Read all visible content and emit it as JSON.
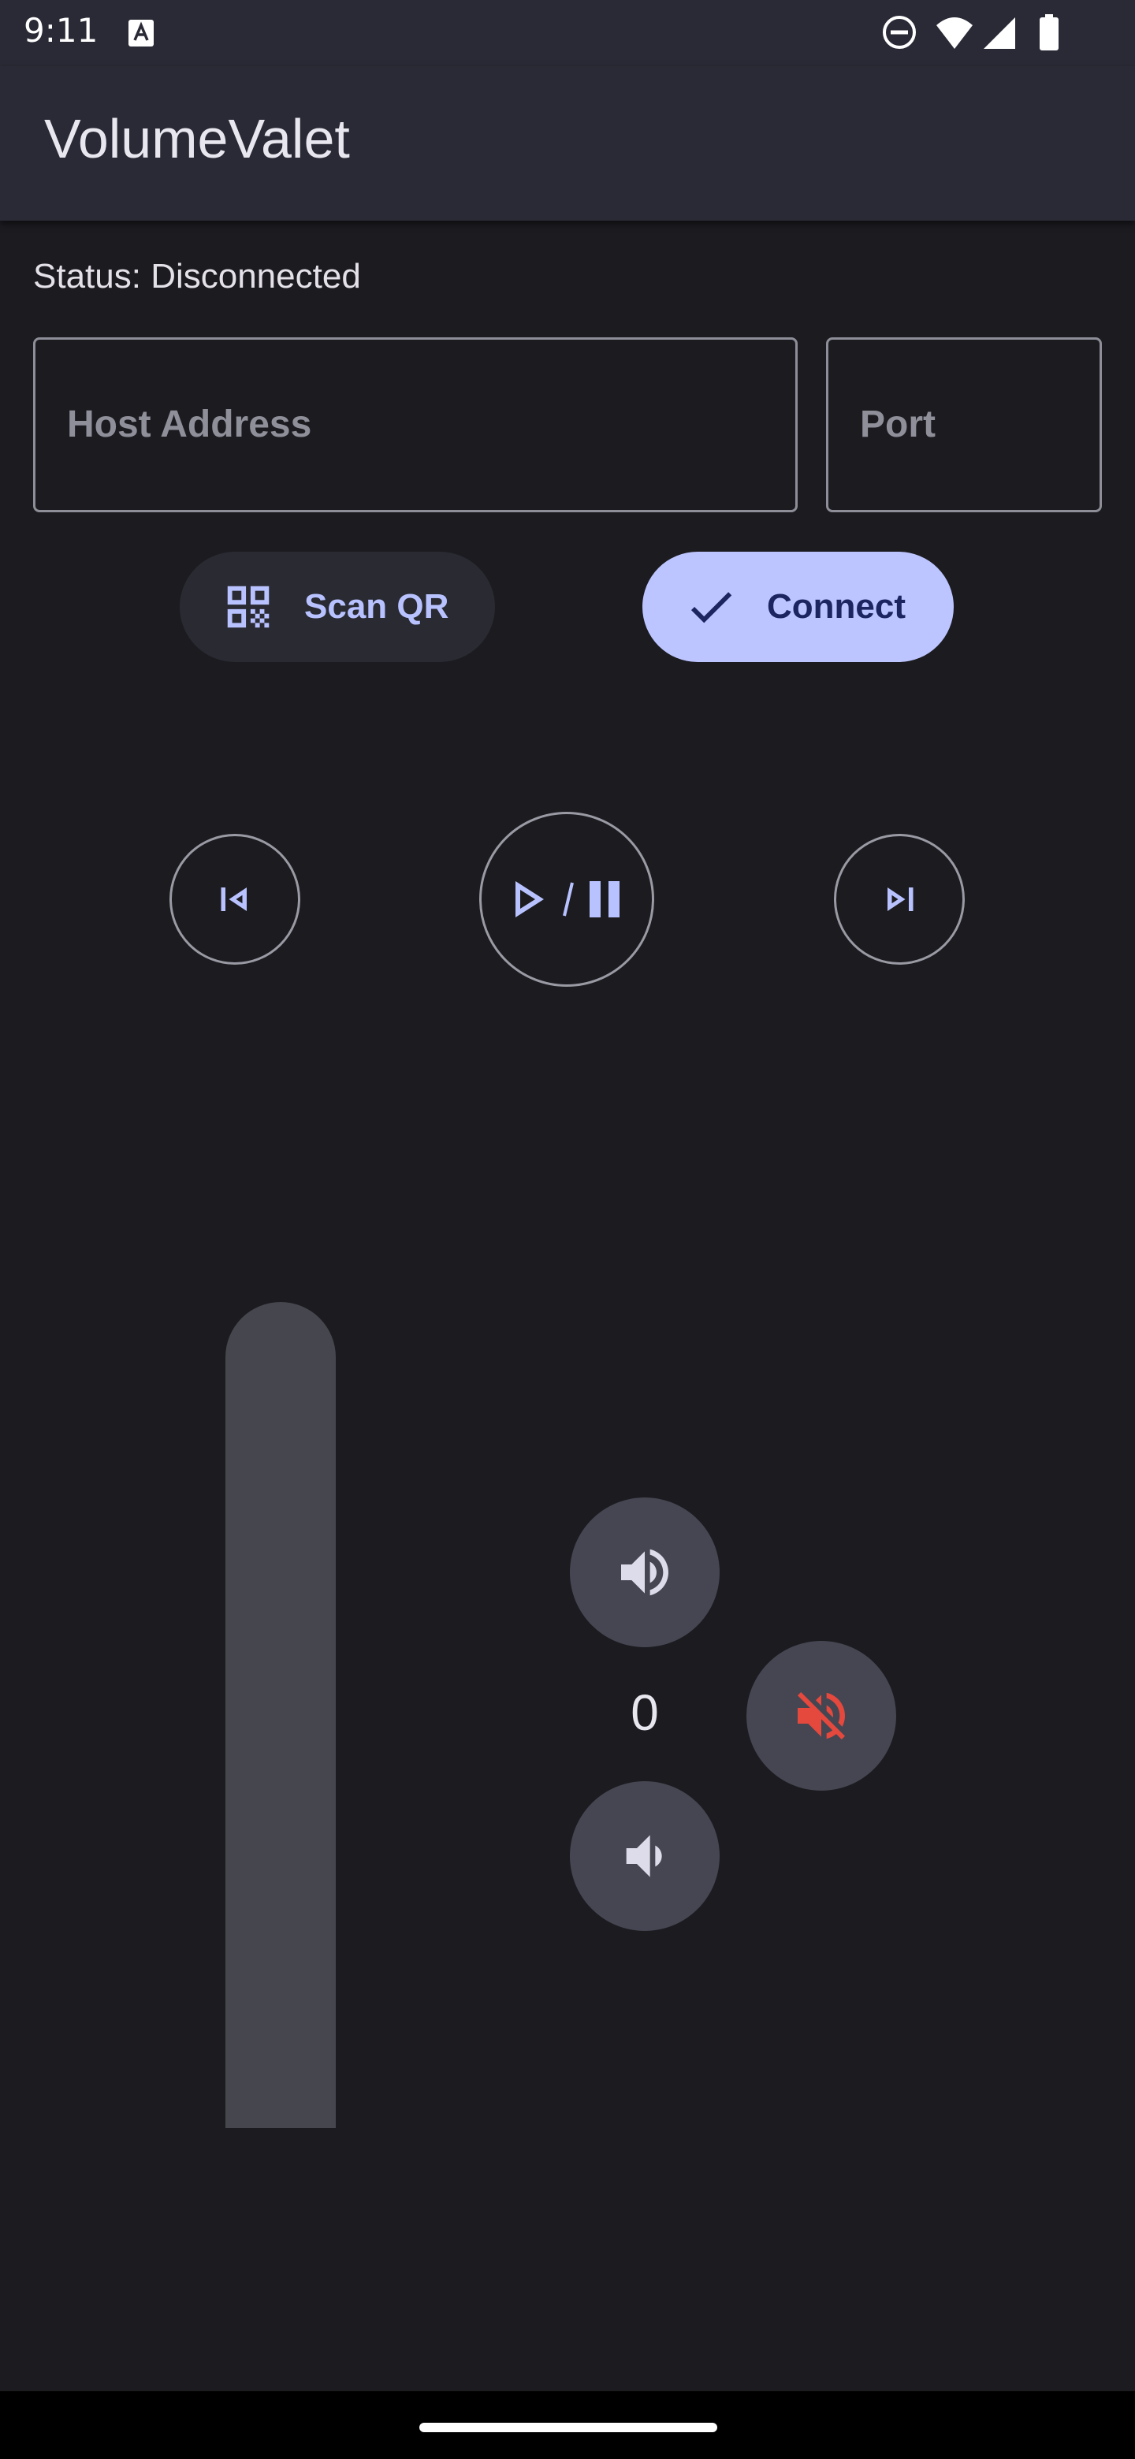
{
  "status_bar": {
    "time": "9:11",
    "icons": [
      "notification-a-icon",
      "do-not-disturb-icon",
      "wifi-icon",
      "cell-signal-icon",
      "battery-icon"
    ]
  },
  "app_bar": {
    "title": "VolumeValet"
  },
  "connection": {
    "status": "Status: Disconnected",
    "host_placeholder": "Host Address",
    "host_value": "",
    "port_placeholder": "Port",
    "port_value": ""
  },
  "actions": {
    "scan_label": "Scan QR",
    "connect_label": "Connect"
  },
  "media": {
    "prev_icon": "skip-previous-icon",
    "play_pause_icon": "play-pause-icon",
    "next_icon": "skip-next-icon"
  },
  "volume": {
    "value": "0",
    "level_fraction": 0,
    "up_icon": "volume-up-icon",
    "down_icon": "volume-down-icon",
    "mute_icon": "volume-off-icon"
  },
  "colors": {
    "background": "#1b1b20",
    "app_bar": "#292a35",
    "accent": "#bcc5ff",
    "accent_text": "#b8c2ff",
    "mute_red": "#e5483d",
    "round_button": "#454652"
  }
}
